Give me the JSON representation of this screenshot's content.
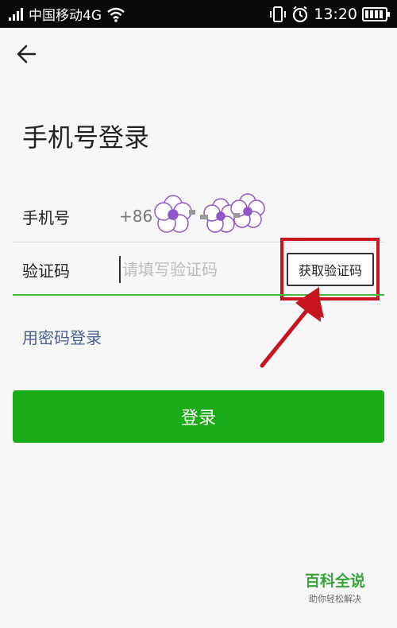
{
  "status_bar": {
    "carrier": "中国移动4G",
    "time": "13:20"
  },
  "header": {
    "title": "手机号登录"
  },
  "form": {
    "phone_label": "手机号",
    "phone_value": "+86",
    "code_label": "验证码",
    "code_placeholder": "请填写验证码",
    "get_code_label": "获取验证码",
    "password_login_link": "用密码登录",
    "login_button": "登录"
  },
  "annotation": {
    "highlight_color": "#c8141e"
  },
  "colors": {
    "primary": "#1aac19",
    "link": "#4a5f8c",
    "status_bar_bg": "#0a0a0a",
    "page_bg": "#f7f7f7"
  },
  "watermark": {
    "title": "百科全说",
    "subtitle": "助你轻松解决"
  }
}
